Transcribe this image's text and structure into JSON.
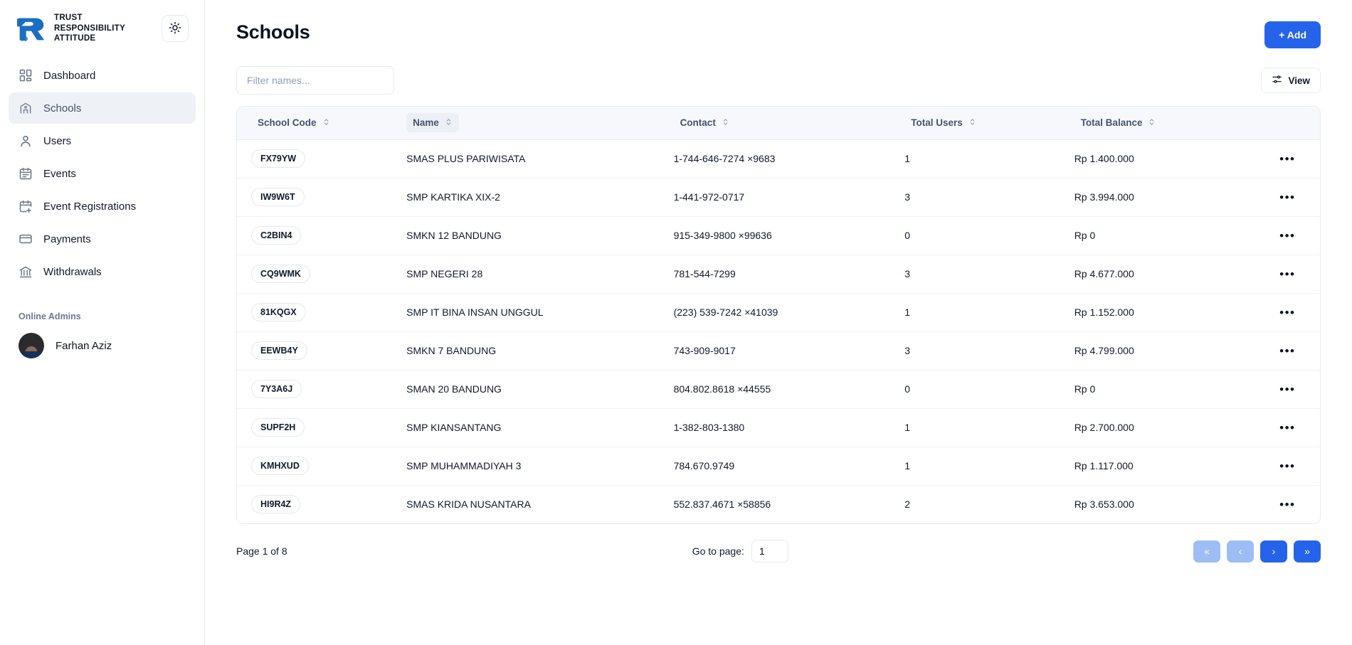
{
  "brand": {
    "name_lines": "TRUST\nRESPONSIBILITY\nATTITUDE",
    "accent_color": "#1a6fc4"
  },
  "sidebar": {
    "theme_toggle_icon": "sun-icon",
    "items": [
      {
        "label": "Dashboard",
        "icon": "dashboard-grid-icon",
        "active": false
      },
      {
        "label": "Schools",
        "icon": "school-building-icon",
        "active": true
      },
      {
        "label": "Users",
        "icon": "user-icon",
        "active": false
      },
      {
        "label": "Events",
        "icon": "calendar-icon",
        "active": false
      },
      {
        "label": "Event Registrations",
        "icon": "calendar-plus-icon",
        "active": false
      },
      {
        "label": "Payments",
        "icon": "credit-card-icon",
        "active": false
      },
      {
        "label": "Withdrawals",
        "icon": "bank-icon",
        "active": false
      }
    ],
    "online_admins_title": "Online Admins",
    "online_admins": [
      {
        "name": "Farhan Aziz"
      }
    ]
  },
  "header": {
    "title": "Schools",
    "add_label": "+ Add",
    "add_color": "#2563eb"
  },
  "toolbar": {
    "filter_placeholder": "Filter names...",
    "filter_value": "",
    "view_label": "View",
    "view_icon": "sliders-icon"
  },
  "table": {
    "columns": [
      {
        "label": "School Code",
        "sortable": true,
        "highlighted": false
      },
      {
        "label": "Name",
        "sortable": true,
        "highlighted": true
      },
      {
        "label": "Contact",
        "sortable": true,
        "highlighted": false
      },
      {
        "label": "Total Users",
        "sortable": true,
        "highlighted": false
      },
      {
        "label": "Total Balance",
        "sortable": true,
        "highlighted": false
      },
      {
        "label": "",
        "sortable": false,
        "highlighted": false
      }
    ],
    "rows": [
      {
        "code": "FX79YW",
        "name": "SMAS PLUS PARIWISATA",
        "contact": "1-744-646-7274 ×9683",
        "total_users": "1",
        "total_balance": "Rp 1.400.000"
      },
      {
        "code": "IW9W6T",
        "name": "SMP KARTIKA XIX-2",
        "contact": "1-441-972-0717",
        "total_users": "3",
        "total_balance": "Rp 3.994.000"
      },
      {
        "code": "C2BIN4",
        "name": "SMKN 12 BANDUNG",
        "contact": "915-349-9800 ×99636",
        "total_users": "0",
        "total_balance": "Rp 0"
      },
      {
        "code": "CQ9WMK",
        "name": "SMP NEGERI 28",
        "contact": "781-544-7299",
        "total_users": "3",
        "total_balance": "Rp 4.677.000"
      },
      {
        "code": "81KQGX",
        "name": "SMP IT BINA INSAN UNGGUL",
        "contact": "(223) 539-7242 ×41039",
        "total_users": "1",
        "total_balance": "Rp 1.152.000"
      },
      {
        "code": "EEWB4Y",
        "name": "SMKN 7 BANDUNG",
        "contact": "743-909-9017",
        "total_users": "3",
        "total_balance": "Rp 4.799.000"
      },
      {
        "code": "7Y3A6J",
        "name": "SMAN 20 BANDUNG",
        "contact": "804.802.8618 ×44555",
        "total_users": "0",
        "total_balance": "Rp 0"
      },
      {
        "code": "SUPF2H",
        "name": "SMP KIANSANTANG",
        "contact": "1-382-803-1380",
        "total_users": "1",
        "total_balance": "Rp 2.700.000"
      },
      {
        "code": "KMHXUD",
        "name": "SMP MUHAMMADIYAH 3",
        "contact": "784.670.9749",
        "total_users": "1",
        "total_balance": "Rp 1.117.000"
      },
      {
        "code": "HI9R4Z",
        "name": "SMAS KRIDA NUSANTARA",
        "contact": "552.837.4671 ×58856",
        "total_users": "2",
        "total_balance": "Rp 3.653.000"
      }
    ],
    "row_action_label": "•••"
  },
  "pagination": {
    "page_info": "Page 1 of 8",
    "goto_label": "Go to page:",
    "goto_value": "1",
    "buttons": [
      {
        "glyph": "«",
        "name": "first-page-button",
        "disabled": true
      },
      {
        "glyph": "‹",
        "name": "prev-page-button",
        "disabled": true
      },
      {
        "glyph": "›",
        "name": "next-page-button",
        "disabled": false
      },
      {
        "glyph": "»",
        "name": "last-page-button",
        "disabled": false
      }
    ]
  }
}
